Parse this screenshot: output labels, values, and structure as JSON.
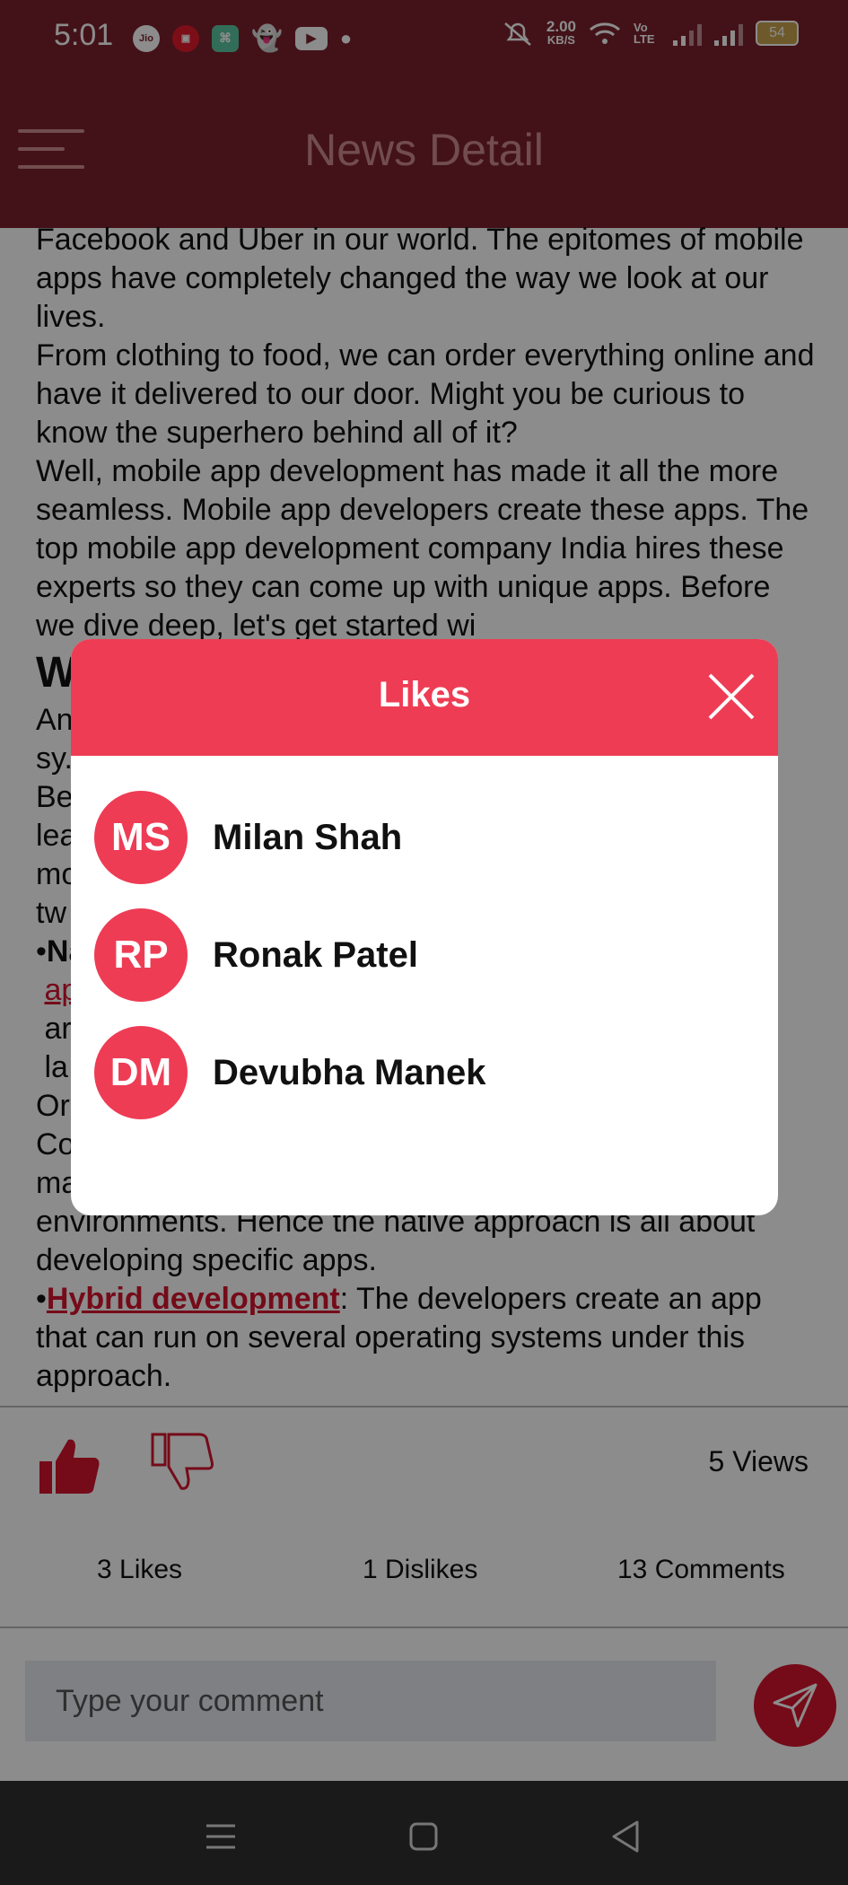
{
  "status": {
    "time": "5:01",
    "speed_value": "2.00",
    "speed_unit": "KB/S",
    "volte": "Vo LTE",
    "battery": "54",
    "icons": [
      "jio-icon",
      "app-icon",
      "app-icon",
      "snapchat-icon",
      "youtube-icon",
      "dot-icon",
      "mute-icon",
      "wifi-icon",
      "signal-icon",
      "battery-icon"
    ]
  },
  "header": {
    "title": "News Detail"
  },
  "article": {
    "p1": "Facebook and Uber in our world. The epitomes of mobile apps have completely changed the way we look at our lives.",
    "p2": "From clothing to food, we can order everything online and have it delivered to our door. Might you be curious to know the superhero behind all of it?",
    "p3": "Well, mobile app development has made it all the more seamless. Mobile app developers create these apps. The top mobile app development company India hires these experts so they can come up with unique apps. Before we dive deep, let's get started wi",
    "heading_fragment": "W",
    "line_an": "An",
    "line_sy": "sy.",
    "line_be": "Be",
    "line_lea": "lea",
    "line_mo": "mo",
    "line_tw": "tw",
    "bullet_na": "Na",
    "link_ap": "ap",
    "line_ar": "ar",
    "line_la": "la",
    "line_or": "Or",
    "line_co": "Co",
    "p_native_tail": "mainly use Swift programming featuring Xcode environments. Hence the native approach is all about developing specific apps.",
    "hybrid_link": "Hybrid development",
    "hybrid_text": ": The developers create an app that can run on several operating systems under this approach."
  },
  "actions": {
    "views": "5 Views"
  },
  "counts": {
    "likes": "3 Likes",
    "dislikes": "1 Dislikes",
    "comments": "13 Comments"
  },
  "comment": {
    "placeholder": "Type your comment"
  },
  "modal": {
    "title": "Likes",
    "users": [
      {
        "initials": "MS",
        "name": "Milan Shah"
      },
      {
        "initials": "RP",
        "name": "Ronak Patel"
      },
      {
        "initials": "DM",
        "name": "Devubha Manek"
      }
    ]
  },
  "colors": {
    "header": "#7a222c",
    "accent": "#ee3c55",
    "link": "#d5152f"
  }
}
